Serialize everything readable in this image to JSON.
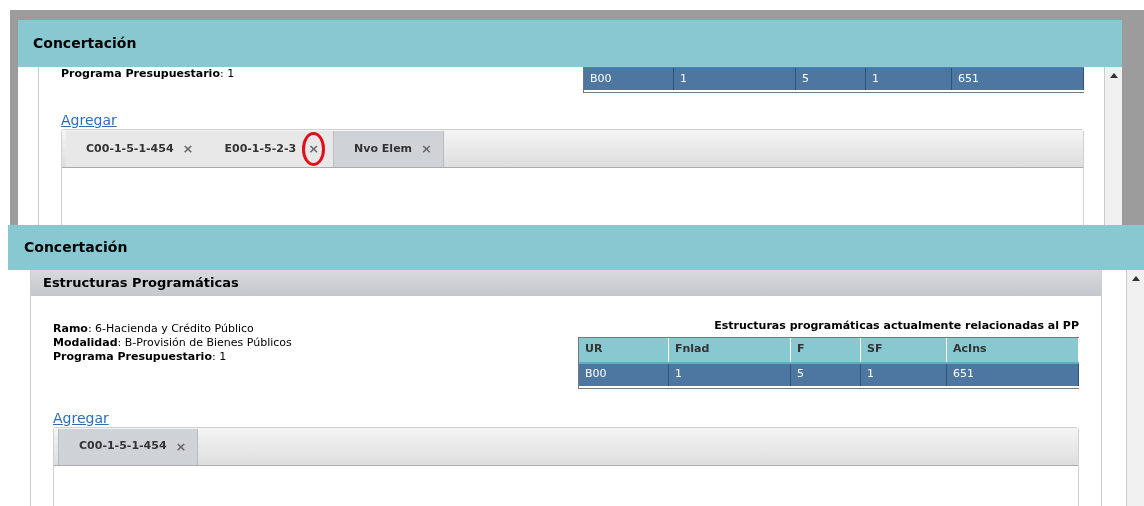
{
  "panels": [
    {
      "title": "Concertación",
      "fields": [
        "**Programa Presupuestario**: 1"
      ],
      "table": {
        "rows": [
          {
            "cells": [
              "B00",
              "1",
              "5",
              "1",
              "651"
            ],
            "selected": true
          }
        ]
      },
      "add_link": "Agregar",
      "tabs": [
        {
          "label": "C00-1-5-1-454",
          "close": "×",
          "selected": false,
          "circled": false
        },
        {
          "label": "E00-1-5-2-3",
          "close": "×",
          "selected": false,
          "circled": true
        },
        {
          "label": "Nvo Elem",
          "close": "×",
          "selected": true,
          "circled": false
        }
      ]
    },
    {
      "title": "Concertación",
      "section_title": "Estructuras Programáticas",
      "fields": [
        "**Ramo**: 6-Hacienda y Crédito Público",
        "**Modalidad**: B-Provisión de Bienes Públicos",
        "**Programa Presupuestario**: 1"
      ],
      "table": {
        "caption": "Estructuras programáticas actualmente relacionadas al PP",
        "columns": [
          "UR",
          "Fnlad",
          "F",
          "SF",
          "AcIns"
        ],
        "rows": [
          {
            "cells": [
              "B00",
              "1",
              "5",
              "1",
              "651"
            ],
            "selected": true
          }
        ]
      },
      "add_link": "Agregar",
      "tabs": [
        {
          "label": "C00-1-5-1-454",
          "close": "×",
          "selected": true,
          "circled": false
        }
      ]
    }
  ]
}
